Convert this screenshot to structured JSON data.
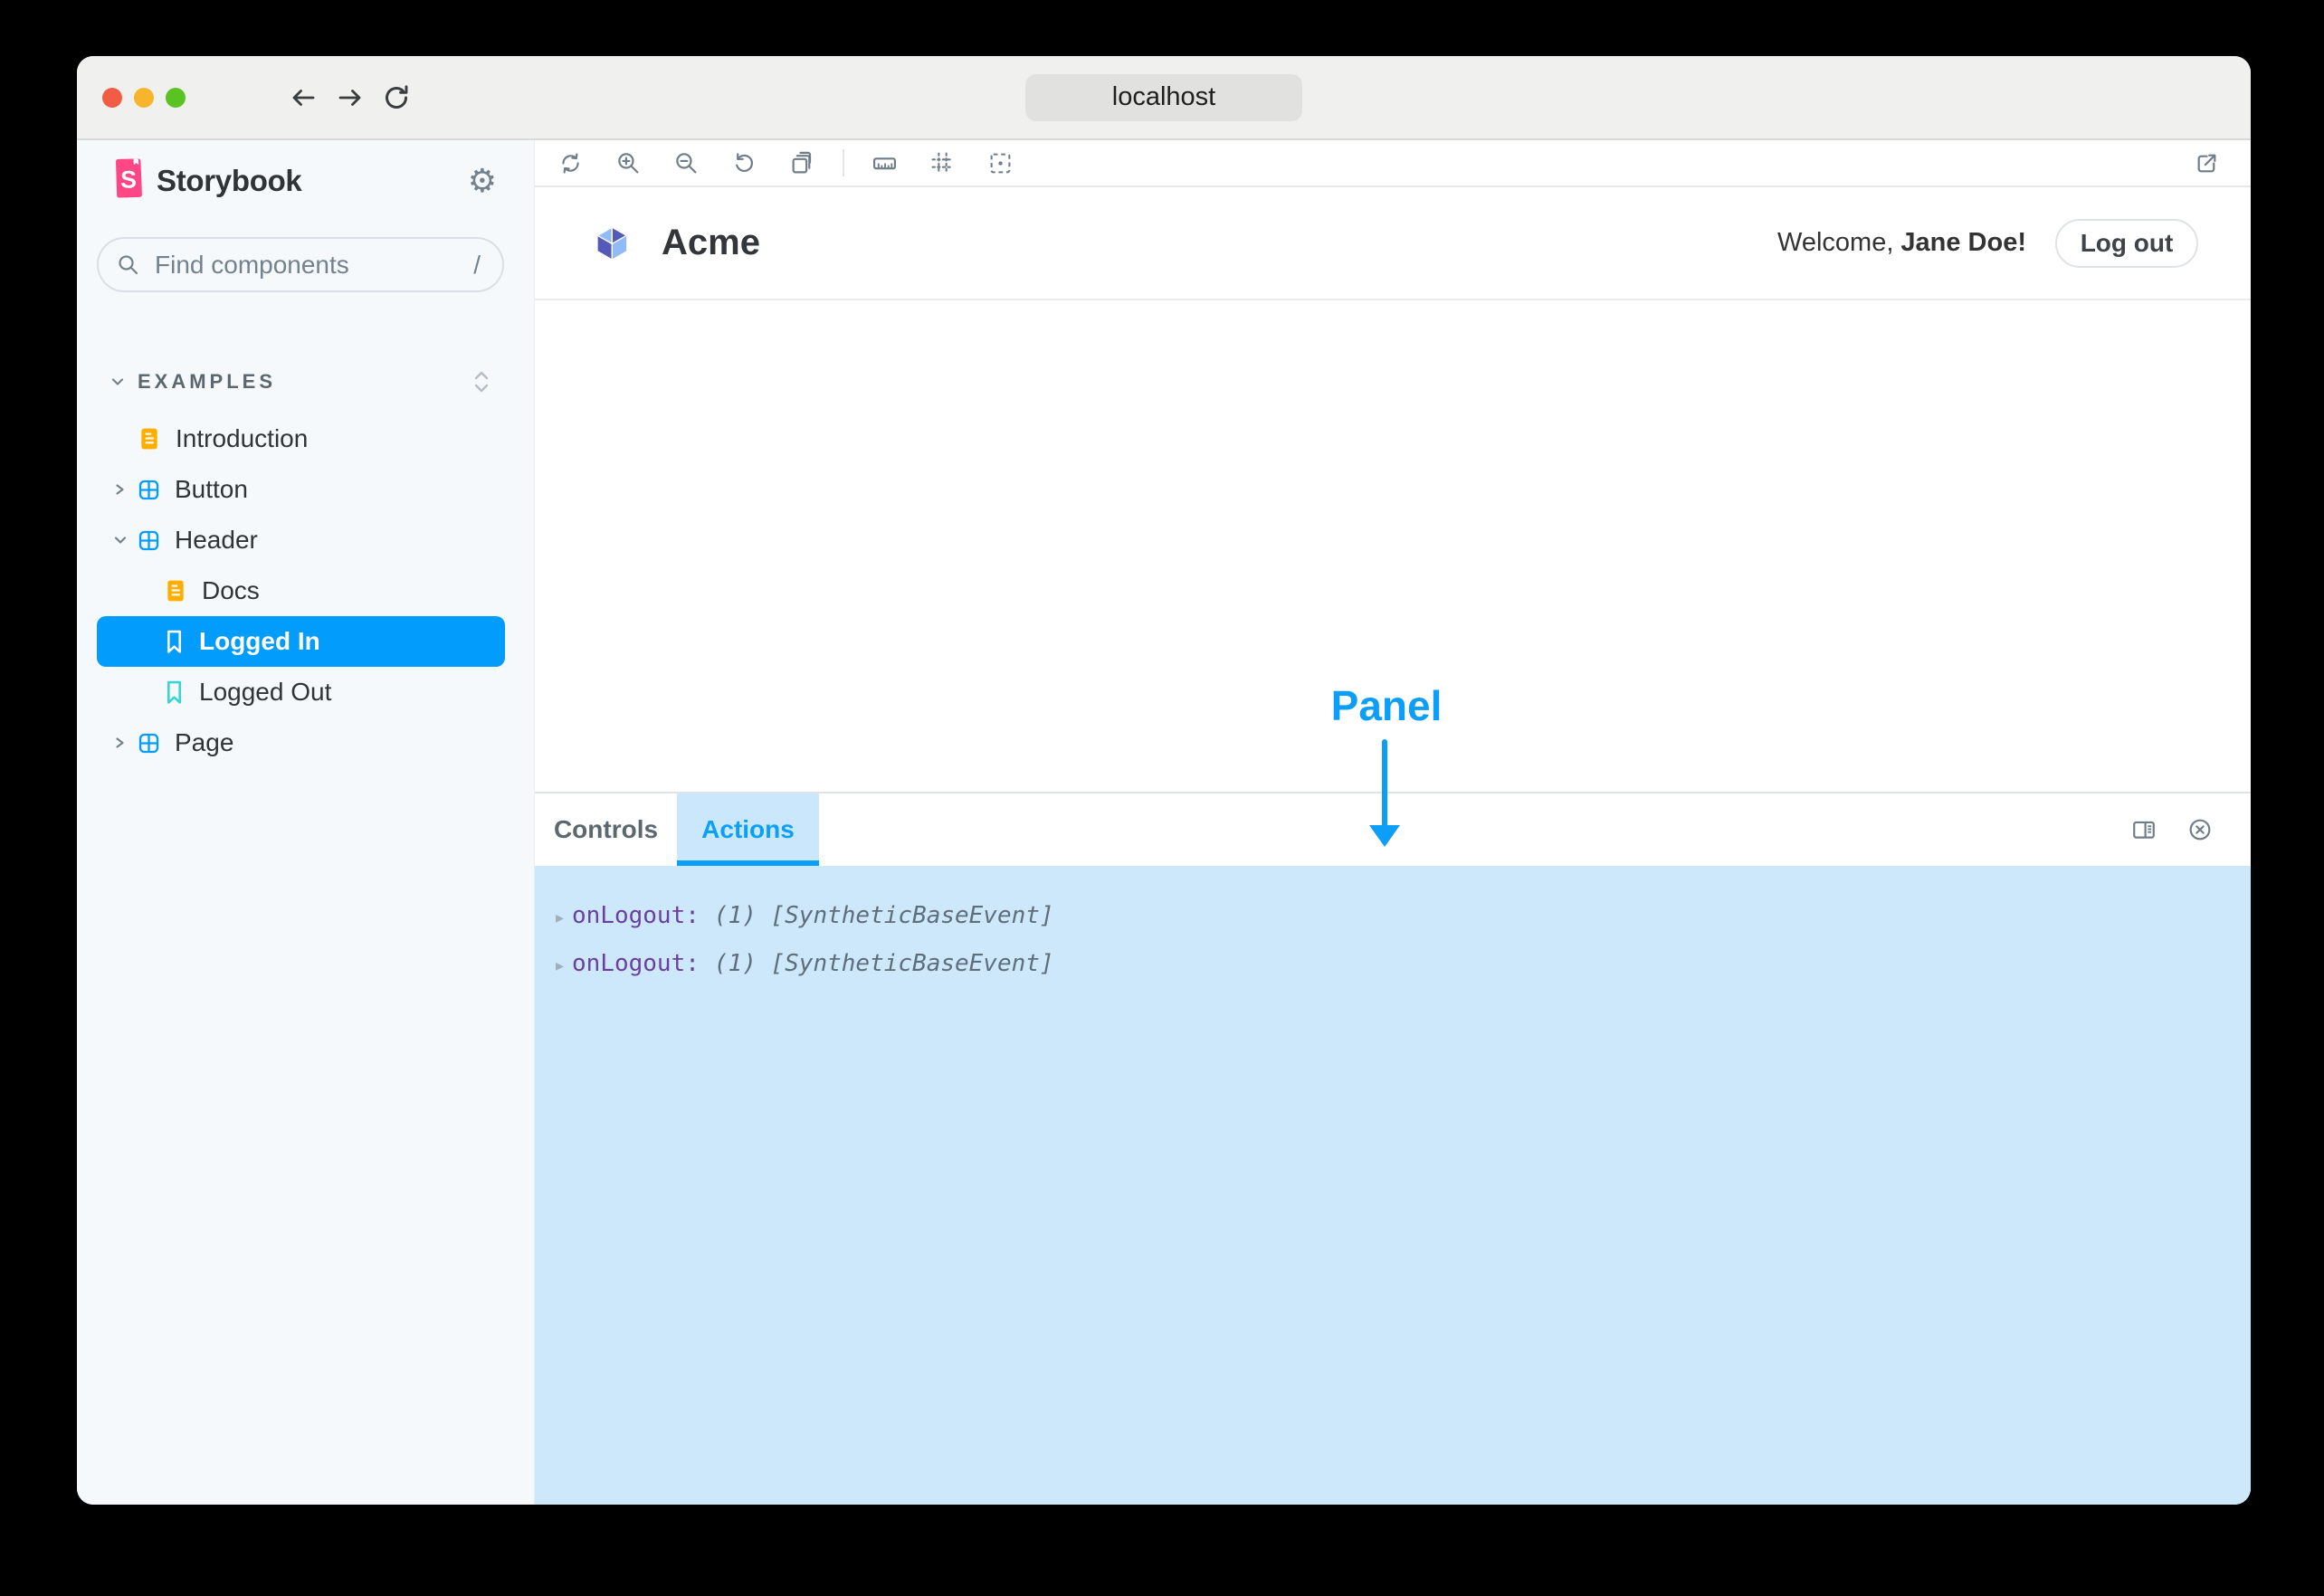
{
  "titlebar": {
    "url": "localhost"
  },
  "sidebar": {
    "brand": "Storybook",
    "search": {
      "placeholder": "Find components",
      "shortcut": "/"
    },
    "section": {
      "label": "EXAMPLES"
    },
    "items": [
      {
        "label": "Introduction",
        "kind": "doc",
        "selected": false
      },
      {
        "label": "Button",
        "kind": "component",
        "expanded": false,
        "selected": false
      },
      {
        "label": "Header",
        "kind": "component",
        "expanded": true,
        "selected": false
      },
      {
        "label": "Docs",
        "kind": "doc",
        "child": true,
        "selected": false
      },
      {
        "label": "Logged In",
        "kind": "story",
        "child": true,
        "selected": true
      },
      {
        "label": "Logged Out",
        "kind": "story",
        "child": true,
        "selected": false
      },
      {
        "label": "Page",
        "kind": "component",
        "expanded": false,
        "selected": false
      }
    ]
  },
  "canvas": {
    "header": {
      "brand": "Acme",
      "welcome_prefix": "Welcome,",
      "user_name": "Jane Doe!",
      "logout_label": "Log out"
    }
  },
  "panel": {
    "tabs": [
      {
        "label": "Controls",
        "active": false
      },
      {
        "label": "Actions",
        "active": true
      }
    ],
    "events": [
      {
        "name": "onLogout:",
        "preview": "(1) [SyntheticBaseEvent]"
      },
      {
        "name": "onLogout:",
        "preview": "(1) [SyntheticBaseEvent]"
      }
    ]
  },
  "annotation": {
    "label": "Panel"
  },
  "colors": {
    "accent_blue": "#029CFD",
    "brand_pink": "#FF4785",
    "doc_orange": "#FFAE00",
    "story_teal": "#37D5D3",
    "annotation_blue": "#0D9FF8",
    "panel_highlight": "#CDE8FB",
    "sidebar_bg": "#F6F9FC"
  }
}
